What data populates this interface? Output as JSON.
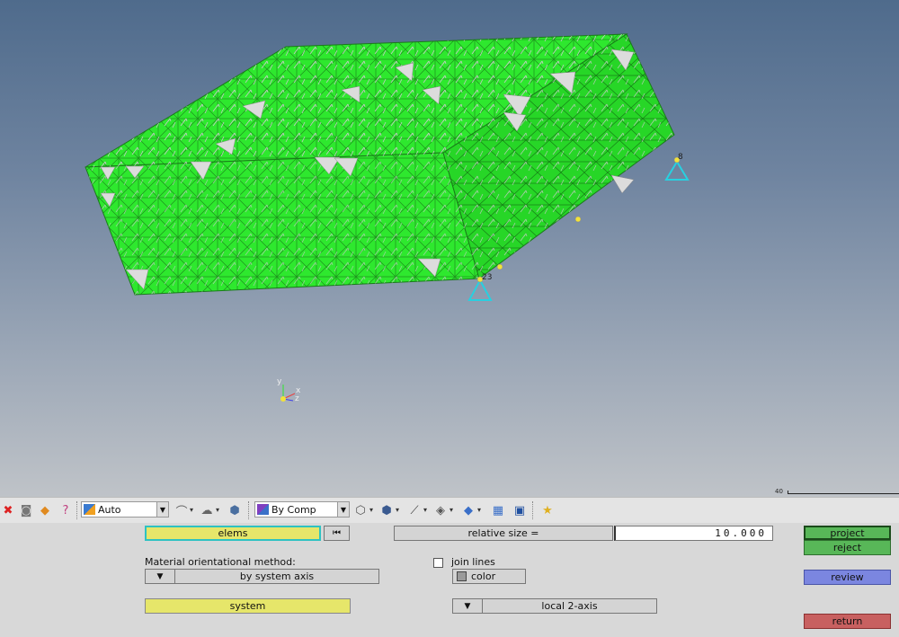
{
  "viewport": {
    "node_label_a": "8",
    "node_label_b": "23",
    "axis_x": "x",
    "axis_y": "y",
    "axis_z": "z",
    "scale_label": "40"
  },
  "toolbar": {
    "icons": [
      "delete-icon",
      "cylinder-icon",
      "shapes-icon",
      "help-icon"
    ],
    "vis_mode": "Auto",
    "color_mode": "By Comp"
  },
  "panel": {
    "elems_label": "elems",
    "reset_glyph": "⏮",
    "relative_size_label": "relative size =",
    "relative_size_value": "10.000",
    "material_method_label": "Material orientational method:",
    "method_value": "by system axis",
    "system_label": "system",
    "join_lines_label": "join lines",
    "color_label": "color",
    "axis_value": "local 2-axis",
    "project_label": "project",
    "reject_label": "reject",
    "review_label": "review",
    "return_label": "return"
  },
  "colors": {
    "mesh_green": "#2ee82e",
    "selected_yellow": "#e6e66a",
    "project_green": "#58b758",
    "review_blue": "#7b86e0",
    "return_red": "#c86060",
    "constraint_cyan": "#28d0e0"
  }
}
